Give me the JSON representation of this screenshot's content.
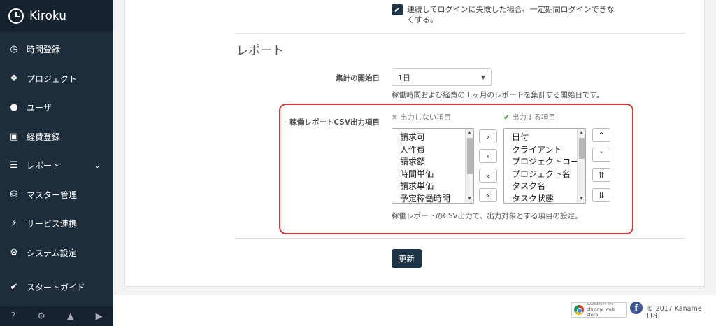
{
  "app": {
    "title": "Kiroku"
  },
  "sidebar": {
    "items": [
      {
        "label": "時間登録",
        "icon": "clock-icon"
      },
      {
        "label": "プロジェクト",
        "icon": "cubes-icon"
      },
      {
        "label": "ユーザ",
        "icon": "user-icon"
      },
      {
        "label": "経費登録",
        "icon": "bus-icon"
      },
      {
        "label": "レポート",
        "icon": "list-icon",
        "expandable": true
      },
      {
        "label": "マスター管理",
        "icon": "database-icon"
      },
      {
        "label": "サービス連携",
        "icon": "plug-icon"
      },
      {
        "label": "システム設定",
        "icon": "gear-icon"
      }
    ],
    "start_guide": {
      "label": "スタートガイド",
      "icon": "check-icon"
    },
    "footer_icons": [
      "help-icon",
      "settings-icon",
      "lock-icon",
      "play-icon"
    ]
  },
  "lockout": {
    "checked": true,
    "text": "連続してログインに失敗した場合、一定期間ログインできなくする。"
  },
  "report": {
    "section_title": "レポート",
    "start_day": {
      "label": "集計の開始日",
      "value": "1日",
      "help": "稼働時間および経費の１ヶ月のレポートを集計する開始日です。"
    },
    "csv": {
      "label": "稼働レポートCSV出力項目",
      "excluded_header": "出力しない項目",
      "included_header": "出力する項目",
      "excluded_items": [
        "請求可",
        "人件費",
        "請求額",
        "時間単価",
        "請求単価",
        "予定稼働時間"
      ],
      "included_items": [
        "日付",
        "クライアント",
        "プロジェクトコード",
        "プロジェクト名",
        "タスク名",
        "タスク状態"
      ],
      "move_buttons": [
        "›",
        "‹",
        "»",
        "«"
      ],
      "order_buttons": [
        "^",
        "˅",
        "⇈",
        "⇊"
      ],
      "help": "稼働レポートのCSV出力で、出力対象とする項目の設定。"
    },
    "update_label": "更新"
  },
  "footer": {
    "cws_line1": "available in the",
    "cws_line2": "chrome web store",
    "fb": "f",
    "copyright": "© 2017 Kaname Ltd."
  }
}
